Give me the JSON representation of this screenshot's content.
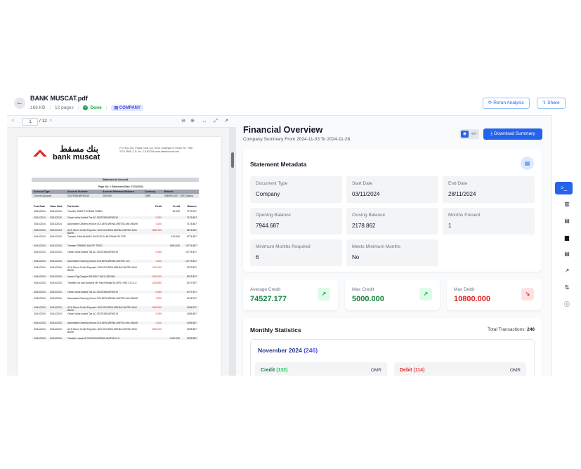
{
  "header": {
    "file_name": "BANK MUSCAT.pdf",
    "file_size": "166 KB",
    "pages": "12 pages",
    "status": "Done",
    "category": "COMPANY",
    "rerun_label": "Rerun Analysis",
    "share_label": "Share"
  },
  "pdf": {
    "current_page": "1",
    "total_pages": "/ 12",
    "logo_ar": "بنك مسقط",
    "logo_en": "bank muscat",
    "address": "P.O. Box 134, Postal Code 112, Ruwi, Sultanate of Oman Tel: +968 2479 5555, C.R. No.: 1/18079/8 www.bankmuscat.com",
    "statement_header": "Statement of Account",
    "statement_info": "Page No: 1    Statement Date: 27/11/2024",
    "account_headers": [
      "Account Type",
      "Account Number:",
      "Account Minimum Balance",
      "Currency",
      "Branch:"
    ],
    "account_values": [
      "Current Account",
      "0337035188790019",
      "200.000",
      "OMR",
      "0983910207 - 0337-Barka"
    ],
    "tx_headers": [
      "Post Date",
      "Value Date",
      "Particular",
      "Debit",
      "Credit",
      "Balance"
    ],
    "transactions": [
      [
        "03/11/2024",
        "03/11/2024",
        "Transfer 25530 THOMAS SOBIN",
        "",
        "60.000",
        "7175.937"
      ],
      [
        "03/11/2024",
        "03/11/2024",
        "Oman Value Added Tax AC 0337035188790019",
        "0.050",
        "",
        "7175.887"
      ],
      [
        "03/11/2024",
        "03/11/2024",
        "Automated Clearing House GOLDEN ARENA UNITED AHLI BANK",
        "1.000",
        "",
        "7174.887"
      ],
      [
        "03/11/2024",
        "03/11/2024",
        "ACH Direct Credit Payment 1619 GOLDEN ARENA UNITED AHLI BANK",
        "1500.000",
        "",
        "5674.887"
      ],
      [
        "04/11/2024",
        "04/11/2024",
        "Transfer SHAHNAWAZ MUSCAT ALMUTAMAYZA TRD",
        "",
        "100.000",
        "5774.887"
      ],
      [
        "04/11/2024",
        "04/11/2024",
        "Transfer 7999800 SALFIE TRDG",
        "",
        "5000.000",
        "10774.887"
      ],
      [
        "04/11/2024",
        "04/11/2024",
        "Oman Value Added Tax AC 0337035188790019",
        "0.050",
        "",
        "10774.837"
      ],
      [
        "04/11/2024",
        "04/11/2024",
        "Automated Clearing House GOLDEN ARENA UNITED LLC",
        "1.000",
        "",
        "10773.837"
      ],
      [
        "04/11/2024",
        "04/11/2024",
        "ACH Direct Credit Payment 1269 GOLDEN ARENA UNITED AHLI BANK",
        "1700.000",
        "",
        "9073.837"
      ],
      [
        "04/11/2024",
        "04/11/2024",
        "Inward Clg Cheque 90110517 M/111.BSOHR",
        "1000.000",
        "",
        "8073.837"
      ],
      [
        "04/11/2024",
        "04/11/2024",
        "Transfer cut and customs HH Patch filings SILVER LYNX CO LLC",
        "1325.850",
        "",
        "6747.987"
      ],
      [
        "04/11/2024",
        "04/11/2024",
        "Oman Value Added Tax AC 0337035188790019",
        "0.050",
        "",
        "6747.937"
      ],
      [
        "04/11/2024",
        "04/11/2024",
        "Automated Clearing House GOLDEN ARENA UNITED AHLI BANK",
        "1.000",
        "",
        "6746.937"
      ],
      [
        "04/11/2024",
        "04/11/2024",
        "ACH Direct Credit Payment 1619 GOLDEN ARENA UNITED AHLI BANK",
        "2450.000",
        "",
        "4296.937"
      ],
      [
        "04/11/2024",
        "04/11/2024",
        "Oman Value Added Tax AC 0337035188790019",
        "0.050",
        "",
        "4296.887"
      ],
      [
        "04/11/2024",
        "04/11/2024",
        "Automated Clearing House GOLDEN ARENA UNITED AHLI BANK",
        "1.000",
        "",
        "4295.887"
      ],
      [
        "04/11/2024",
        "04/11/2024",
        "ACH Direct Credit Payment 1619 GOLDEN ARENA UNITED AHLI BANK",
        "2000.000",
        "",
        "2295.887"
      ],
      [
        "04/11/2024",
        "04/11/2024",
        "Transfer rowas M GOLDEN ARENA UNITED LLC",
        "",
        "1000.000",
        "3295.887"
      ]
    ]
  },
  "overview": {
    "title": "Financial Overview",
    "subtitle": "Company Summary From 2024-11-03 To 2024-11-28.",
    "download_label": "Download Summary"
  },
  "metadata": {
    "title": "Statement Metadata",
    "fields": [
      {
        "label": "Document Type",
        "value": "Company"
      },
      {
        "label": "Start Date",
        "value": "03/11/2024"
      },
      {
        "label": "End Date",
        "value": "28/11/2024"
      },
      {
        "label": "Opening Balance",
        "value": "7944.687"
      },
      {
        "label": "Closing Balance",
        "value": "2178.862"
      },
      {
        "label": "Months Present",
        "value": "1"
      },
      {
        "label": "Minimum Months Required",
        "value": "6"
      },
      {
        "label": "Meets Minimum Months",
        "value": "No"
      }
    ]
  },
  "stats": [
    {
      "label": "Average Credit",
      "value": "74527.177",
      "trend": "up"
    },
    {
      "label": "Max Credit",
      "value": "5000.000",
      "trend": "up"
    },
    {
      "label": "Max Debit",
      "value": "10800.000",
      "trend": "down"
    }
  ],
  "monthly": {
    "title": "Monthly Statistics",
    "total_label": "Total Transactions:",
    "total_value": "246",
    "month": "November 2024",
    "month_count": "(246)",
    "credit_label": "Credit",
    "credit_count": "(132)",
    "debit_label": "Debit",
    "debit_count": "(114)",
    "currency": "OMR"
  },
  "colors": {
    "accent": "#2563eb",
    "success": "#16a34a",
    "danger": "#dc2626"
  },
  "rail_icons": [
    "terminal-icon",
    "bar-chart-icon",
    "document-icon",
    "book-icon",
    "file-text-icon",
    "trend-icon",
    "sort-icon",
    "info-icon"
  ]
}
